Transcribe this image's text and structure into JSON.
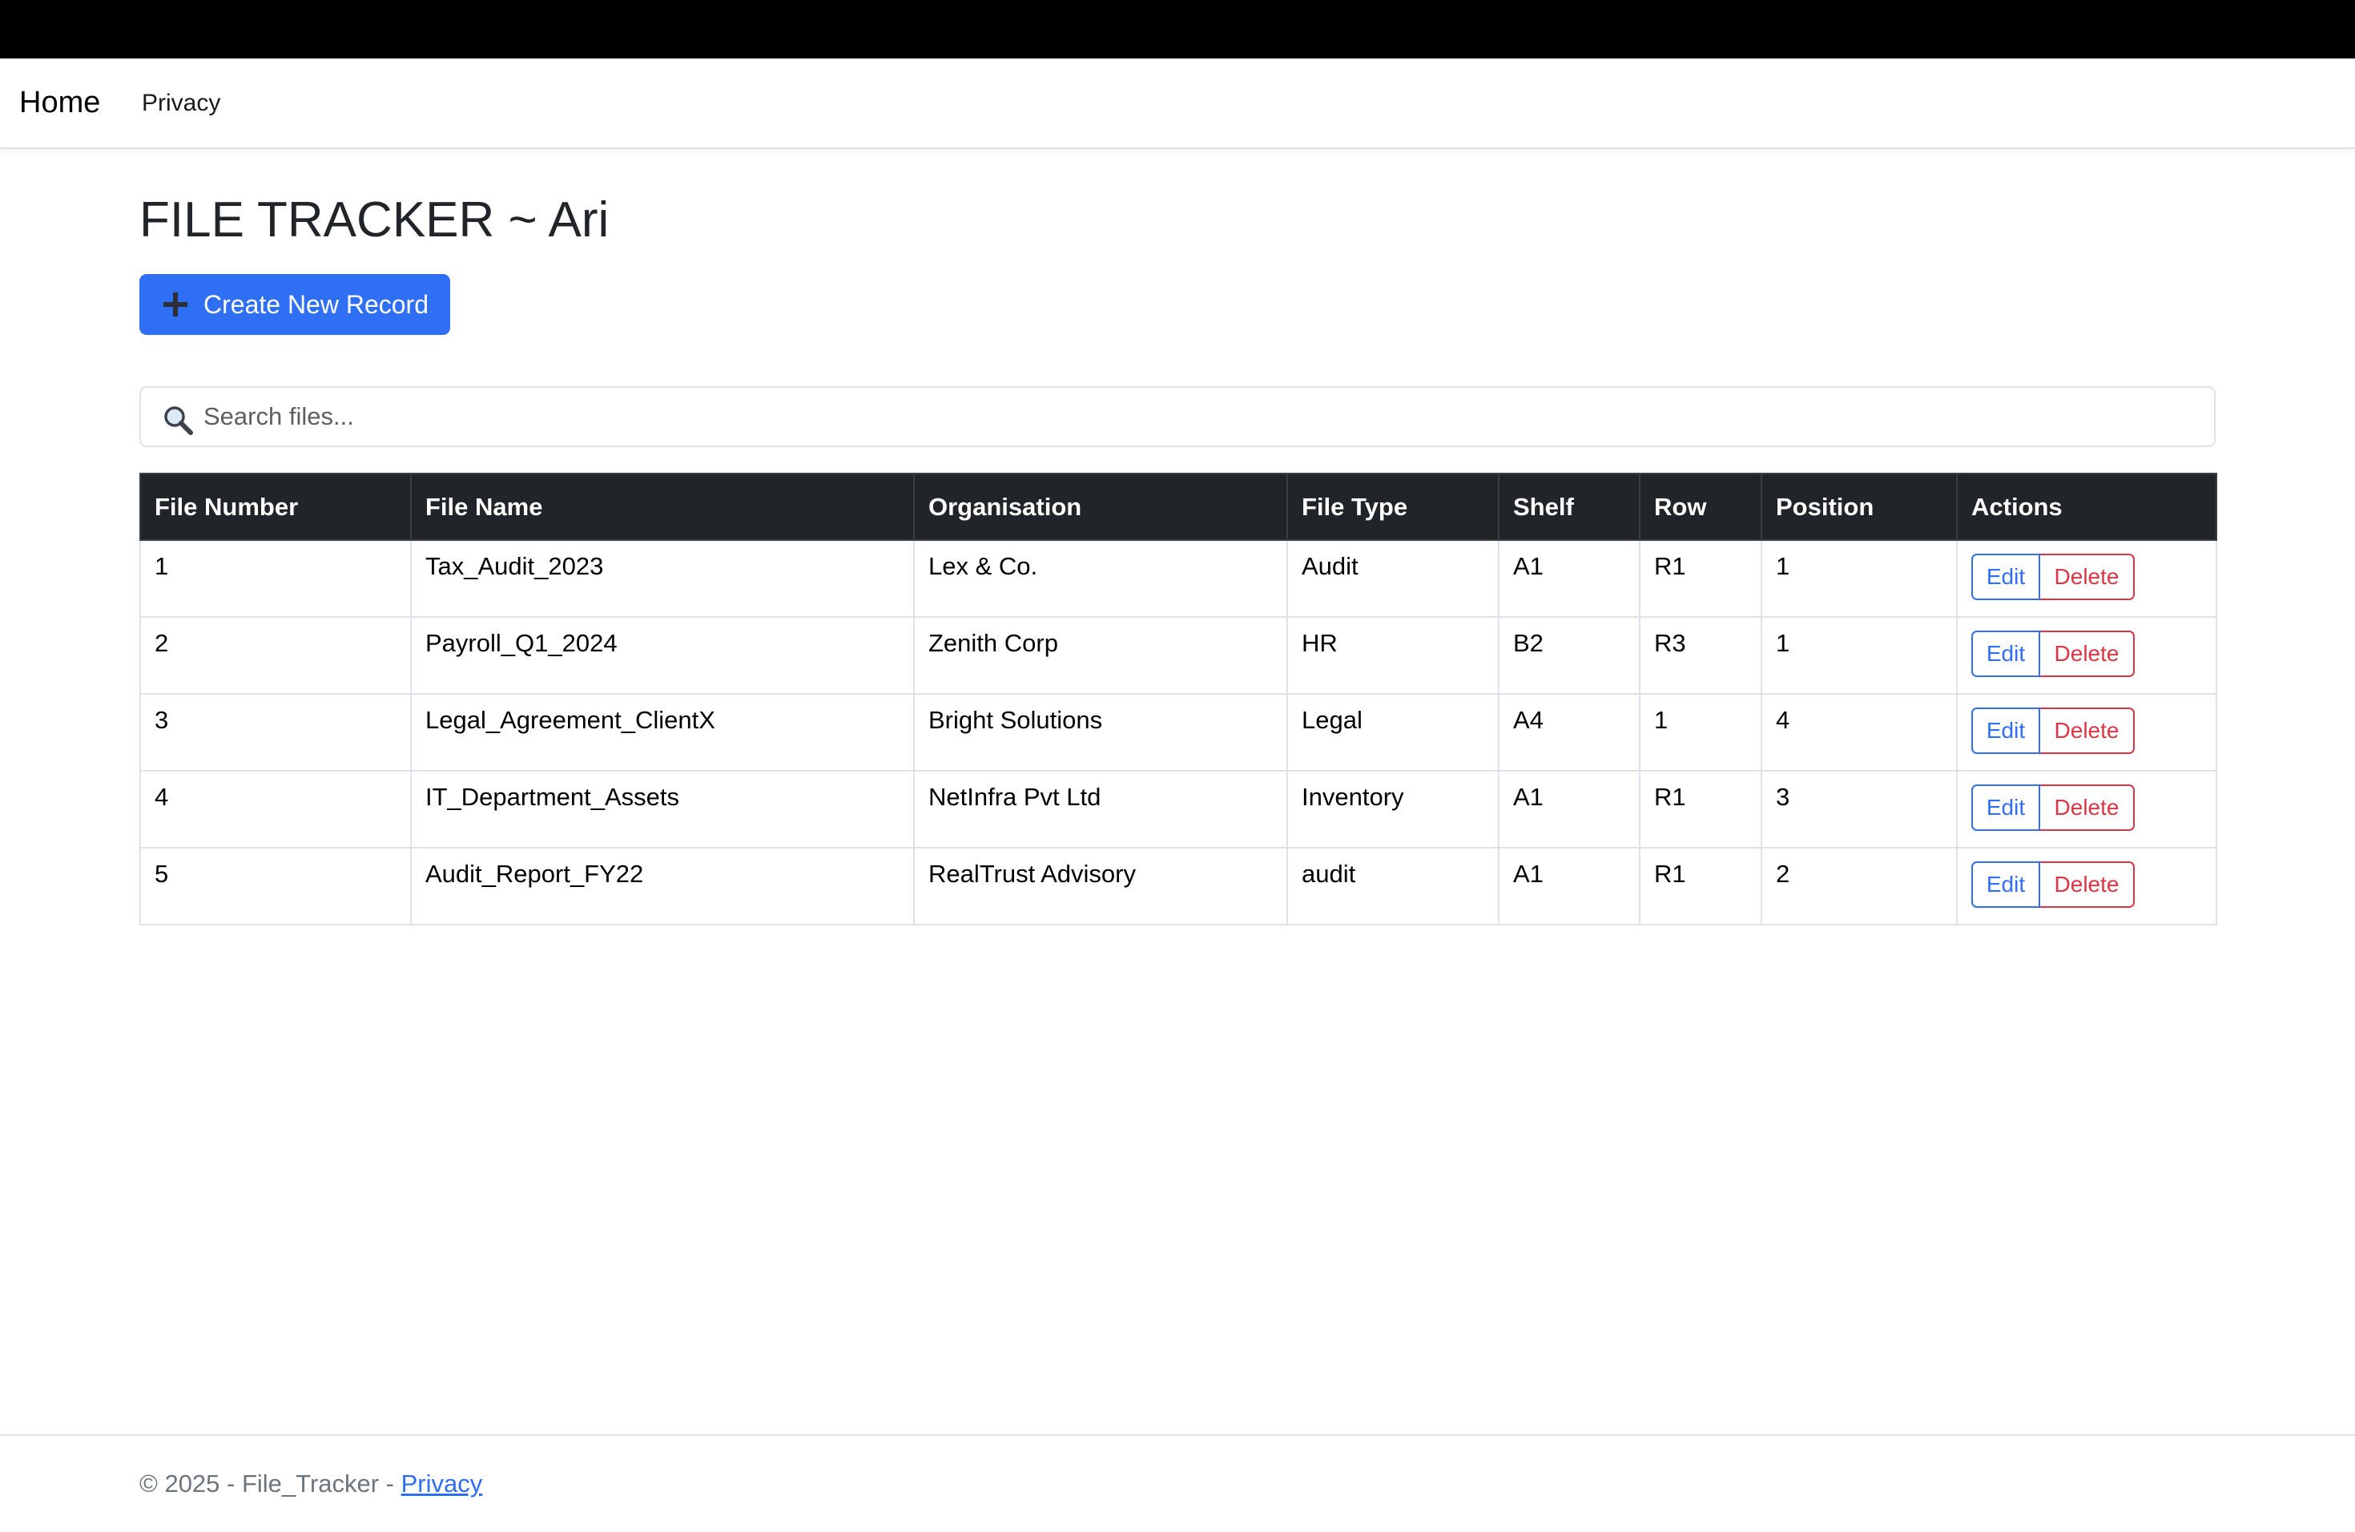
{
  "nav": {
    "brand": "Home",
    "links": [
      "Privacy"
    ]
  },
  "page": {
    "title": "FILE TRACKER ~ Ari",
    "create_button": "Create New Record"
  },
  "search": {
    "placeholder": "Search files...",
    "icon": "magnifier-icon"
  },
  "table": {
    "headers": [
      "File Number",
      "File Name",
      "Organisation",
      "File Type",
      "Shelf",
      "Row",
      "Position",
      "Actions"
    ],
    "rows": [
      [
        "1",
        "Tax_Audit_2023",
        "Lex & Co.",
        "Audit",
        "A1",
        "R1",
        "1"
      ],
      [
        "2",
        "Payroll_Q1_2024",
        "Zenith Corp",
        "HR",
        "B2",
        "R3",
        "1"
      ],
      [
        "3",
        "Legal_Agreement_ClientX",
        "Bright Solutions",
        "Legal",
        "A4",
        "1",
        "4"
      ],
      [
        "4",
        "IT_Department_Assets",
        "NetInfra Pvt Ltd",
        "Inventory",
        "A1",
        "R1",
        "3"
      ],
      [
        "5",
        "Audit_Report_FY22",
        "RealTrust Advisory",
        "audit",
        "A1",
        "R1",
        "2"
      ]
    ],
    "edit_label": "Edit",
    "delete_label": "Delete"
  },
  "footer": {
    "text": "© 2025 - File_Tracker - ",
    "link": "Privacy"
  },
  "colors": {
    "primary": "#2f6ff3",
    "danger": "#dc3545",
    "table_header": "#212529"
  }
}
